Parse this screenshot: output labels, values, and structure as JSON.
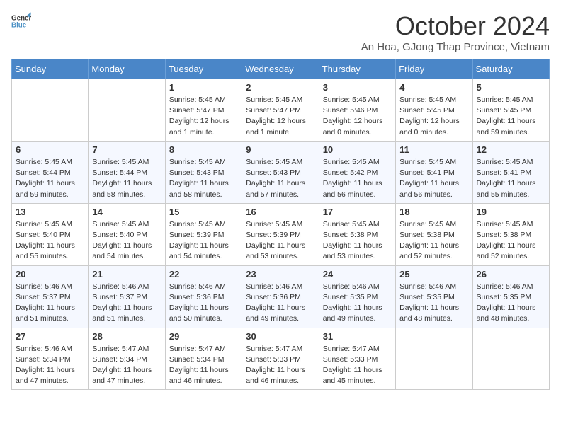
{
  "header": {
    "logo_line1": "General",
    "logo_line2": "Blue",
    "month_title": "October 2024",
    "subtitle": "An Hoa, GJong Thap Province, Vietnam"
  },
  "days_of_week": [
    "Sunday",
    "Monday",
    "Tuesday",
    "Wednesday",
    "Thursday",
    "Friday",
    "Saturday"
  ],
  "weeks": [
    [
      {
        "day": "",
        "info": ""
      },
      {
        "day": "",
        "info": ""
      },
      {
        "day": "1",
        "info": "Sunrise: 5:45 AM\nSunset: 5:47 PM\nDaylight: 12 hours and 1 minute."
      },
      {
        "day": "2",
        "info": "Sunrise: 5:45 AM\nSunset: 5:47 PM\nDaylight: 12 hours and 1 minute."
      },
      {
        "day": "3",
        "info": "Sunrise: 5:45 AM\nSunset: 5:46 PM\nDaylight: 12 hours and 0 minutes."
      },
      {
        "day": "4",
        "info": "Sunrise: 5:45 AM\nSunset: 5:45 PM\nDaylight: 12 hours and 0 minutes."
      },
      {
        "day": "5",
        "info": "Sunrise: 5:45 AM\nSunset: 5:45 PM\nDaylight: 11 hours and 59 minutes."
      }
    ],
    [
      {
        "day": "6",
        "info": "Sunrise: 5:45 AM\nSunset: 5:44 PM\nDaylight: 11 hours and 59 minutes."
      },
      {
        "day": "7",
        "info": "Sunrise: 5:45 AM\nSunset: 5:44 PM\nDaylight: 11 hours and 58 minutes."
      },
      {
        "day": "8",
        "info": "Sunrise: 5:45 AM\nSunset: 5:43 PM\nDaylight: 11 hours and 58 minutes."
      },
      {
        "day": "9",
        "info": "Sunrise: 5:45 AM\nSunset: 5:43 PM\nDaylight: 11 hours and 57 minutes."
      },
      {
        "day": "10",
        "info": "Sunrise: 5:45 AM\nSunset: 5:42 PM\nDaylight: 11 hours and 56 minutes."
      },
      {
        "day": "11",
        "info": "Sunrise: 5:45 AM\nSunset: 5:41 PM\nDaylight: 11 hours and 56 minutes."
      },
      {
        "day": "12",
        "info": "Sunrise: 5:45 AM\nSunset: 5:41 PM\nDaylight: 11 hours and 55 minutes."
      }
    ],
    [
      {
        "day": "13",
        "info": "Sunrise: 5:45 AM\nSunset: 5:40 PM\nDaylight: 11 hours and 55 minutes."
      },
      {
        "day": "14",
        "info": "Sunrise: 5:45 AM\nSunset: 5:40 PM\nDaylight: 11 hours and 54 minutes."
      },
      {
        "day": "15",
        "info": "Sunrise: 5:45 AM\nSunset: 5:39 PM\nDaylight: 11 hours and 54 minutes."
      },
      {
        "day": "16",
        "info": "Sunrise: 5:45 AM\nSunset: 5:39 PM\nDaylight: 11 hours and 53 minutes."
      },
      {
        "day": "17",
        "info": "Sunrise: 5:45 AM\nSunset: 5:38 PM\nDaylight: 11 hours and 53 minutes."
      },
      {
        "day": "18",
        "info": "Sunrise: 5:45 AM\nSunset: 5:38 PM\nDaylight: 11 hours and 52 minutes."
      },
      {
        "day": "19",
        "info": "Sunrise: 5:45 AM\nSunset: 5:38 PM\nDaylight: 11 hours and 52 minutes."
      }
    ],
    [
      {
        "day": "20",
        "info": "Sunrise: 5:46 AM\nSunset: 5:37 PM\nDaylight: 11 hours and 51 minutes."
      },
      {
        "day": "21",
        "info": "Sunrise: 5:46 AM\nSunset: 5:37 PM\nDaylight: 11 hours and 51 minutes."
      },
      {
        "day": "22",
        "info": "Sunrise: 5:46 AM\nSunset: 5:36 PM\nDaylight: 11 hours and 50 minutes."
      },
      {
        "day": "23",
        "info": "Sunrise: 5:46 AM\nSunset: 5:36 PM\nDaylight: 11 hours and 49 minutes."
      },
      {
        "day": "24",
        "info": "Sunrise: 5:46 AM\nSunset: 5:35 PM\nDaylight: 11 hours and 49 minutes."
      },
      {
        "day": "25",
        "info": "Sunrise: 5:46 AM\nSunset: 5:35 PM\nDaylight: 11 hours and 48 minutes."
      },
      {
        "day": "26",
        "info": "Sunrise: 5:46 AM\nSunset: 5:35 PM\nDaylight: 11 hours and 48 minutes."
      }
    ],
    [
      {
        "day": "27",
        "info": "Sunrise: 5:46 AM\nSunset: 5:34 PM\nDaylight: 11 hours and 47 minutes."
      },
      {
        "day": "28",
        "info": "Sunrise: 5:47 AM\nSunset: 5:34 PM\nDaylight: 11 hours and 47 minutes."
      },
      {
        "day": "29",
        "info": "Sunrise: 5:47 AM\nSunset: 5:34 PM\nDaylight: 11 hours and 46 minutes."
      },
      {
        "day": "30",
        "info": "Sunrise: 5:47 AM\nSunset: 5:33 PM\nDaylight: 11 hours and 46 minutes."
      },
      {
        "day": "31",
        "info": "Sunrise: 5:47 AM\nSunset: 5:33 PM\nDaylight: 11 hours and 45 minutes."
      },
      {
        "day": "",
        "info": ""
      },
      {
        "day": "",
        "info": ""
      }
    ]
  ]
}
